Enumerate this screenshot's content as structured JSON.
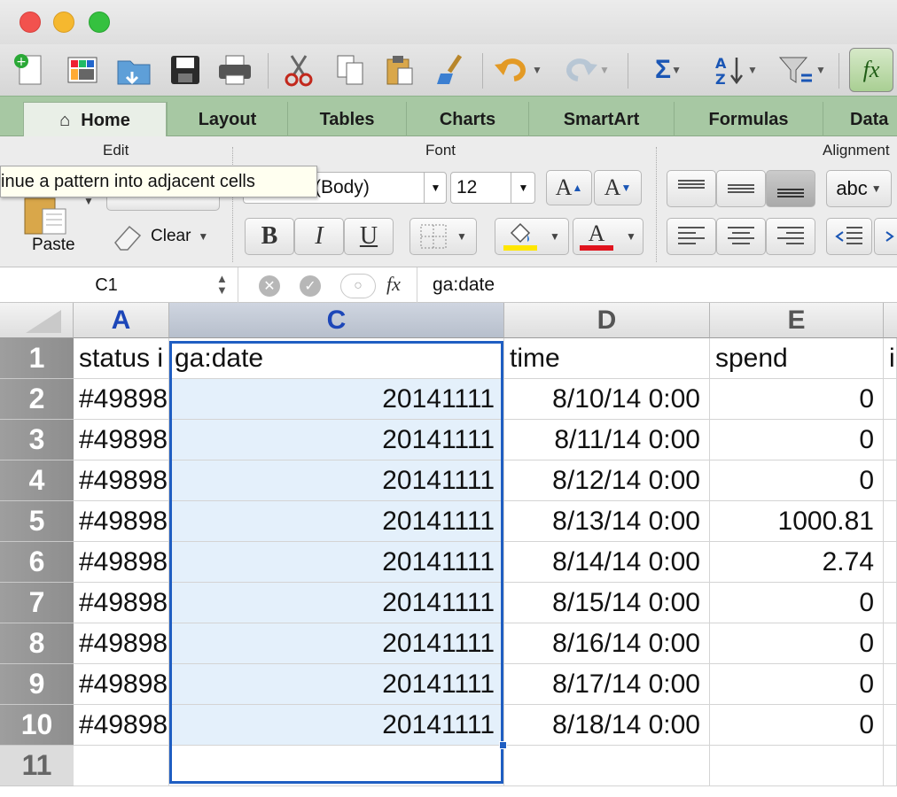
{
  "toolbar": {
    "icons": [
      "new-icon",
      "gallery-icon",
      "open-icon",
      "save-icon",
      "print-icon",
      "cut-icon",
      "copy-icon",
      "paste-icon",
      "format-brush-icon",
      "undo-icon",
      "redo-icon",
      "sum-icon",
      "sort-icon",
      "filter-icon",
      "function-icon"
    ],
    "sum_glyph": "Σ",
    "fx_glyph": "fx"
  },
  "tabs": [
    "Home",
    "Layout",
    "Tables",
    "Charts",
    "SmartArt",
    "Formulas",
    "Data"
  ],
  "ribbon": {
    "groups": {
      "edit": "Edit",
      "font": "Font",
      "alignment": "Alignment"
    },
    "paste_label": "Paste",
    "clear_label": "Clear",
    "font_name": "(Body)",
    "font_size": "12",
    "bold": "B",
    "italic": "I",
    "underline": "U",
    "grow_font": "A",
    "shrink_font": "A",
    "font_color": "A",
    "wrap_label": "abc",
    "accent_fill": "#ffe600",
    "accent_font": "#e0141e"
  },
  "tooltip": "inue a pattern into adjacent cells",
  "formula_bar": {
    "name_box": "C1",
    "fx": "fx",
    "content": "ga:date"
  },
  "grid": {
    "columns": [
      "A",
      "C",
      "D",
      "E"
    ],
    "selected_column": "C",
    "rows": [
      {
        "n": "1",
        "a": "status i",
        "c": "ga:date",
        "d": "time",
        "e": "spend",
        "f": "i"
      },
      {
        "n": "2",
        "a": "#49898",
        "c": "20141111",
        "d": "8/10/14 0:00",
        "e": "0"
      },
      {
        "n": "3",
        "a": "#49898",
        "c": "20141111",
        "d": "8/11/14 0:00",
        "e": "0"
      },
      {
        "n": "4",
        "a": "#49898",
        "c": "20141111",
        "d": "8/12/14 0:00",
        "e": "0"
      },
      {
        "n": "5",
        "a": "#49898",
        "c": "20141111",
        "d": "8/13/14 0:00",
        "e": "1000.81"
      },
      {
        "n": "6",
        "a": "#49898",
        "c": "20141111",
        "d": "8/14/14 0:00",
        "e": "2.74"
      },
      {
        "n": "7",
        "a": "#49898",
        "c": "20141111",
        "d": "8/15/14 0:00",
        "e": "0"
      },
      {
        "n": "8",
        "a": "#49898",
        "c": "20141111",
        "d": "8/16/14 0:00",
        "e": "0"
      },
      {
        "n": "9",
        "a": "#49898",
        "c": "20141111",
        "d": "8/17/14 0:00",
        "e": "0"
      },
      {
        "n": "10",
        "a": "#49898",
        "c": "20141111",
        "d": "8/18/14 0:00",
        "e": "0"
      },
      {
        "n": "11",
        "a": "",
        "c": "",
        "d": "",
        "e": ""
      }
    ]
  }
}
